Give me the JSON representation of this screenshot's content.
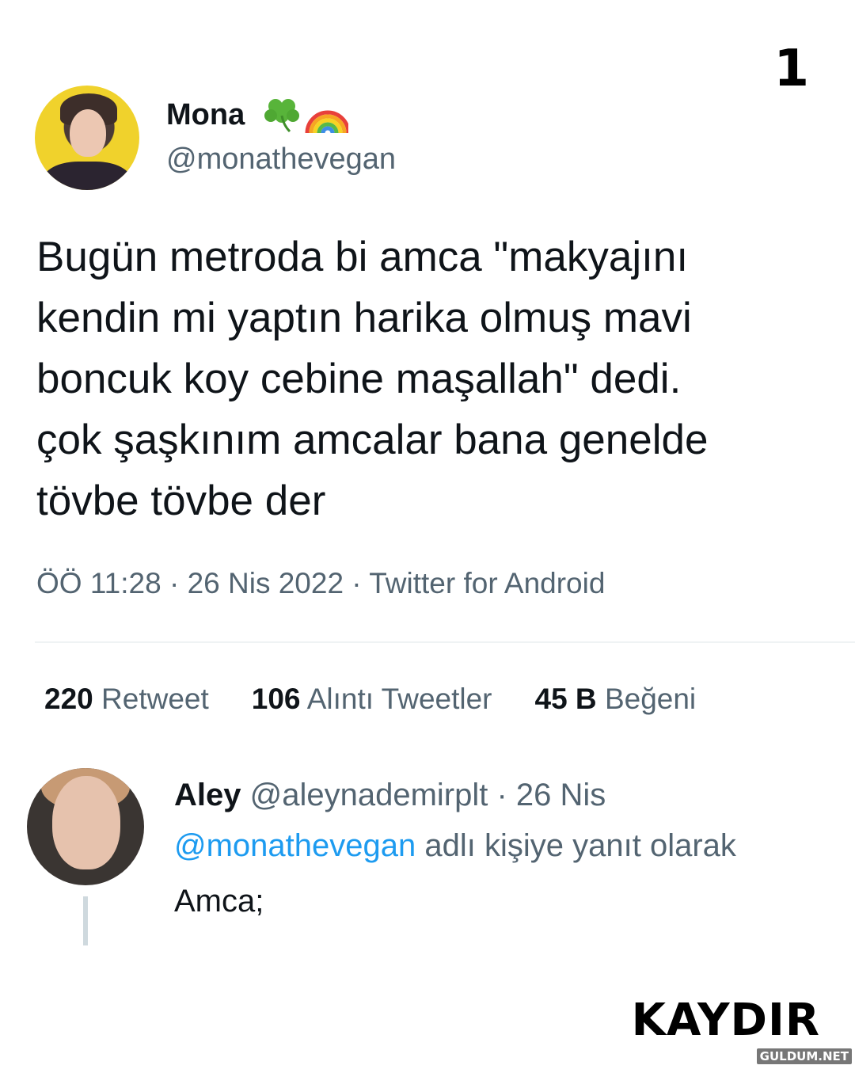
{
  "page_number": "1",
  "tweet": {
    "display_name": "Mona",
    "name_emojis": [
      "shamrock-icon",
      "rainbow-icon"
    ],
    "handle": "@monathevegan",
    "text_lines": [
      "Bugün metroda bi amca \"makyajını",
      "kendin mi yaptın harika olmuş mavi",
      "boncuk koy cebine maşallah\" dedi.",
      "çok şaşkınım amcalar bana genelde",
      "tövbe tövbe der"
    ],
    "meta": "ÖÖ 11:28 · 26 Nis 2022 · Twitter for Android",
    "stats": [
      {
        "count": "220",
        "label": "Retweet"
      },
      {
        "count": "106",
        "label": "Alıntı Tweetler"
      },
      {
        "count": "45 B",
        "label": "Beğeni"
      }
    ]
  },
  "reply": {
    "display_name": "Aley",
    "handle_date": "@aleynademirplt · 26 Nis",
    "mention": "@monathevegan",
    "reply_to_suffix": " adlı kişiye yanıt olarak",
    "text": "Amca;"
  },
  "scroll_hint": "KAYDIR",
  "watermark": "GULDUM.NET",
  "colors": {
    "text": "#0f1419",
    "secondary": "#536471",
    "link": "#1d9bf0"
  }
}
